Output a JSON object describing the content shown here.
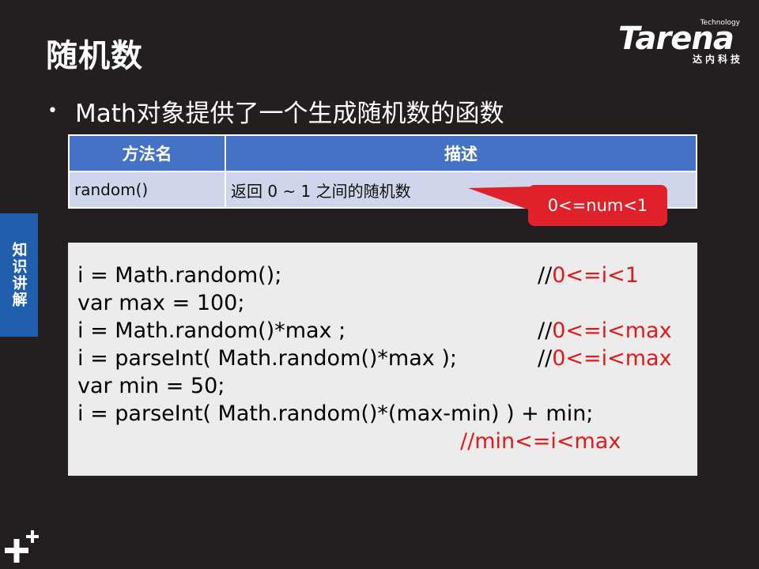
{
  "slide": {
    "title": "随机数",
    "bullet": "Math对象提供了一个生成随机数的函数"
  },
  "logo": {
    "tech": "Technology",
    "word": "Tarena",
    "sub": "达内科技"
  },
  "table": {
    "headers": [
      "方法名",
      "描述"
    ],
    "rows": [
      [
        "random()",
        "返回 0 ~ 1 之间的随机数"
      ]
    ]
  },
  "callout": {
    "text": "0<=num<1"
  },
  "code": {
    "lines": [
      {
        "text": "i = Math.random();",
        "comment_prefix": "//",
        "comment": "0<=i<1"
      },
      {
        "text": "var max = 100;",
        "comment_prefix": "",
        "comment": ""
      },
      {
        "text": "i = Math.random()*max ;",
        "comment_prefix": "//",
        "comment": "0<=i<max"
      },
      {
        "text": "i = parseInt( Math.random()*max );",
        "comment_prefix": "//",
        "comment": "0<=i<max"
      },
      {
        "text": "var min = 50;",
        "comment_prefix": "",
        "comment": ""
      },
      {
        "text": "i = parseInt( Math.random()*(max-min) ) + min;",
        "comment_prefix": "",
        "comment": ""
      }
    ],
    "trailing_comment": "//min<=i<max"
  },
  "side_tab": {
    "label": "知识讲解"
  },
  "colors": {
    "background": "#231f20",
    "table_header": "#4472c4",
    "table_row": "#cfd5ea",
    "callout": "#e0202a",
    "code_bg": "#ececec",
    "comment_red": "#e01a1a",
    "side_tab": "#1f5fae"
  },
  "icons": {
    "corner": "plus-icon"
  }
}
